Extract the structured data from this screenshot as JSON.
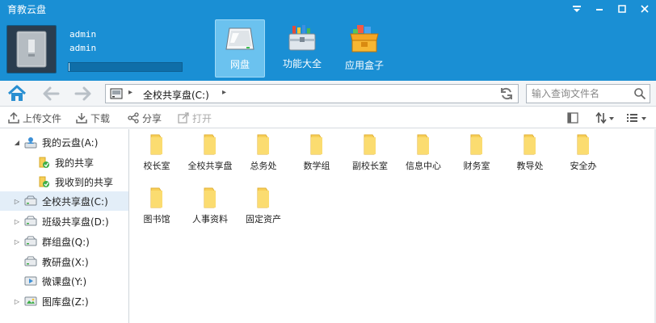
{
  "app": {
    "title": "育教云盘"
  },
  "user": {
    "name": "admin",
    "account": "admin",
    "quota_used_fraction": 0.01
  },
  "nav": {
    "wangpan": "网盘",
    "gongneng": "功能大全",
    "yingyong": "应用盒子"
  },
  "address": {
    "path": "全校共享盘(C:)",
    "search_placeholder": "输入查询文件名"
  },
  "actions": {
    "upload": "上传文件",
    "download": "下载",
    "share": "分享",
    "open": "打开"
  },
  "sidebar": {
    "items": [
      {
        "label": "我的云盘(A:)"
      },
      {
        "label": "我的共享"
      },
      {
        "label": "我收到的共享"
      },
      {
        "label": "全校共享盘(C:)"
      },
      {
        "label": "班级共享盘(D:)"
      },
      {
        "label": "群组盘(Q:)"
      },
      {
        "label": "教研盘(X:)"
      },
      {
        "label": "微课盘(Y:)"
      },
      {
        "label": "图库盘(Z:)"
      }
    ]
  },
  "folders": [
    {
      "name": "校长室"
    },
    {
      "name": "全校共享盘"
    },
    {
      "name": "总务处"
    },
    {
      "name": "数学组"
    },
    {
      "name": "副校长室"
    },
    {
      "name": "信息中心"
    },
    {
      "name": "财务室"
    },
    {
      "name": "教导处"
    },
    {
      "name": "安全办"
    },
    {
      "name": "图书馆"
    },
    {
      "name": "人事资料"
    },
    {
      "name": "固定资产"
    }
  ],
  "colors": {
    "header_bg": "#1a8fd4",
    "active_nav": "#6bc2ef",
    "folder_yellow": "#f7cf57",
    "selected_row": "#e3eef8"
  }
}
